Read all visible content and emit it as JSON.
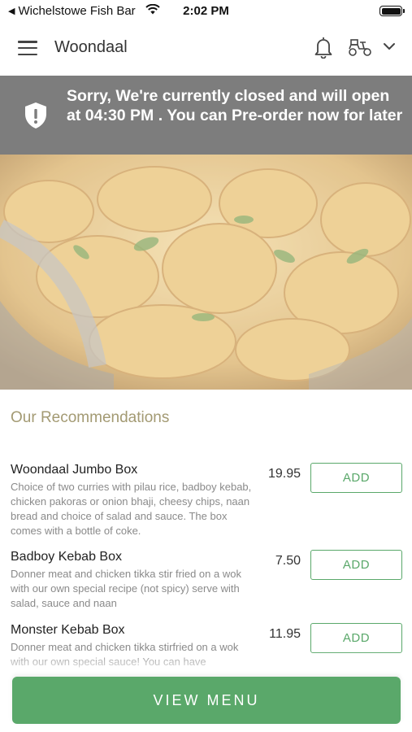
{
  "status_bar": {
    "back_app": "Wichelstowe Fish Bar",
    "time": "2:02 PM"
  },
  "header": {
    "title": "Woondaal",
    "icons": [
      "menu-icon",
      "bell-icon",
      "scooter-icon",
      "chevron-down-icon"
    ]
  },
  "banner": {
    "text": "Sorry, We're currently closed and will open at 04:30 PM . You can Pre-order now for later",
    "icon": "shield-alert-icon",
    "background": "#7d7d7d"
  },
  "recommendations": {
    "title": "Our Recommendations",
    "items": [
      {
        "name": "Woondaal Jumbo Box",
        "description": "Choice of two curries with pilau rice, badboy kebab, chicken pakoras or onion bhaji, cheesy chips, naan bread and choice of salad and sauce. The box comes with a bottle of coke.",
        "price": "19.95",
        "button": "ADD"
      },
      {
        "name": "Badboy Kebab Box",
        "description": "Donner meat and chicken tikka stir fried on a wok with our own special recipe (not spicy) serve with salad, sauce and naan",
        "price": "7.50",
        "button": "ADD"
      },
      {
        "name": "Monster Kebab Box",
        "description": "Donner meat and chicken tikka stirfried on a wok with our own special sauce! You can have",
        "price": "11.95",
        "button": "ADD"
      }
    ]
  },
  "view_menu": {
    "label": "VIEW MENU"
  },
  "colors": {
    "accent": "#5aa86a",
    "section_title": "#a39a73"
  }
}
